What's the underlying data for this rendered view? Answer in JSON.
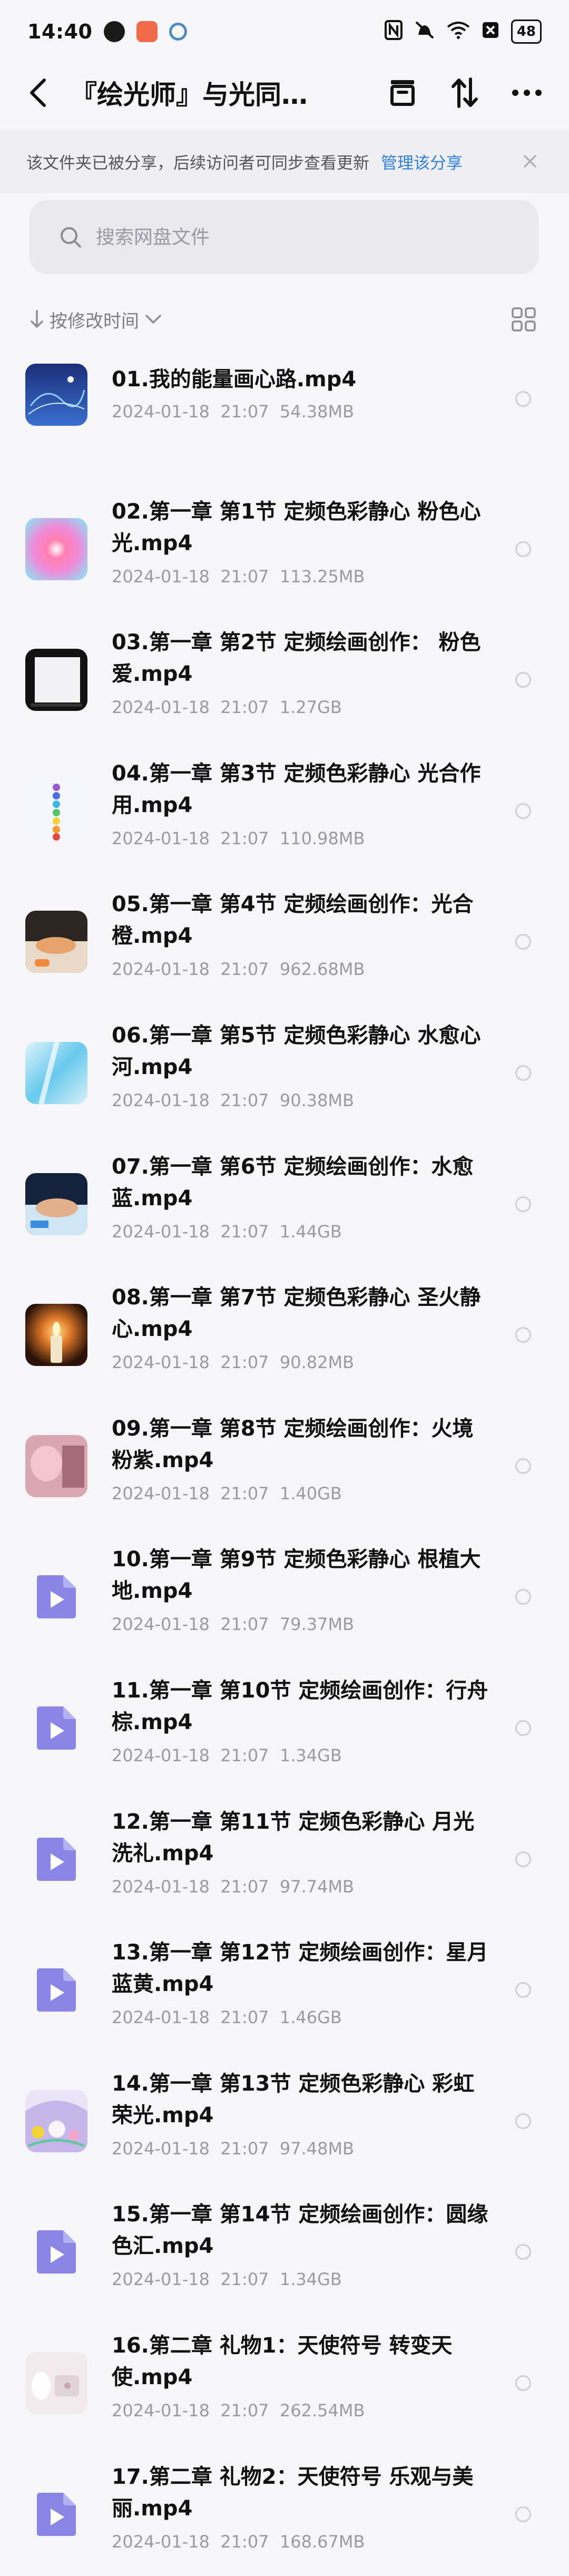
{
  "status_bar": {
    "time": "14:40",
    "battery": "48"
  },
  "header": {
    "title": "『绘光师』与光同…"
  },
  "notice": {
    "text": "该文件夹已被分享，后续访问者可同步查看更新",
    "link": "管理该分享"
  },
  "search": {
    "placeholder": "搜索网盘文件"
  },
  "sort": {
    "label": "按修改时间"
  },
  "colors": {
    "accent": "#2f7fd6",
    "video_icon": "#8a86e6",
    "meta_text": "#9a9aa2",
    "background": "#f6f6f8"
  },
  "files": [
    {
      "name": "01.我的能量画心路.mp4",
      "date": "2024-01-18",
      "time": "21:07",
      "size": "54.38MB",
      "thumb": "blue-lines"
    },
    {
      "name": "02.第一章 第1节 定频色彩静心 粉色心光.mp4",
      "date": "2024-01-18",
      "time": "21:07",
      "size": "113.25MB",
      "thumb": "pink-glow"
    },
    {
      "name": "03.第一章 第2节 定频绘画创作： 粉色 爱.mp4",
      "date": "2024-01-18",
      "time": "21:07",
      "size": "1.27GB",
      "thumb": "white-frame"
    },
    {
      "name": "04.第一章 第3节 定频色彩静心 光合作用.mp4",
      "date": "2024-01-18",
      "time": "21:07",
      "size": "110.98MB",
      "thumb": "chakra"
    },
    {
      "name": "05.第一章 第4节 定频绘画创作：光合 橙.mp4",
      "date": "2024-01-18",
      "time": "21:07",
      "size": "962.68MB",
      "thumb": "hand-orange"
    },
    {
      "name": "06.第一章 第5节 定频色彩静心 水愈心河.mp4",
      "date": "2024-01-18",
      "time": "21:07",
      "size": "90.38MB",
      "thumb": "water-blue"
    },
    {
      "name": "07.第一章 第6节 定频绘画创作：水愈 蓝.mp4",
      "date": "2024-01-18",
      "time": "21:07",
      "size": "1.44GB",
      "thumb": "hand-blue"
    },
    {
      "name": "08.第一章 第7节 定频色彩静心 圣火静心.mp4",
      "date": "2024-01-18",
      "time": "21:07",
      "size": "90.82MB",
      "thumb": "candle"
    },
    {
      "name": "09.第一章 第8节 定频绘画创作：火境 粉紫.mp4",
      "date": "2024-01-18",
      "time": "21:07",
      "size": "1.40GB",
      "thumb": "pink-hand"
    },
    {
      "name": "10.第一章 第9节 定频色彩静心 根植大地.mp4",
      "date": "2024-01-18",
      "time": "21:07",
      "size": "79.37MB",
      "thumb": "video"
    },
    {
      "name": "11.第一章 第10节 定频绘画创作：行舟 棕.mp4",
      "date": "2024-01-18",
      "time": "21:07",
      "size": "1.34GB",
      "thumb": "video"
    },
    {
      "name": "12.第一章 第11节 定频色彩静心 月光洗礼.mp4",
      "date": "2024-01-18",
      "time": "21:07",
      "size": "97.74MB",
      "thumb": "video"
    },
    {
      "name": "13.第一章 第12节 定频绘画创作：星月 蓝黄.mp4",
      "date": "2024-01-18",
      "time": "21:07",
      "size": "1.46GB",
      "thumb": "video"
    },
    {
      "name": "14.第一章 第13节 定频色彩静心 彩虹荣光.mp4",
      "date": "2024-01-18",
      "time": "21:07",
      "size": "97.48MB",
      "thumb": "rainbow"
    },
    {
      "name": "15.第一章 第14节 定频绘画创作：圆缘 色汇.mp4",
      "date": "2024-01-18",
      "time": "21:07",
      "size": "1.34GB",
      "thumb": "video"
    },
    {
      "name": "16.第二章 礼物1：天使符号 转变天使.mp4",
      "date": "2024-01-18",
      "time": "21:07",
      "size": "262.54MB",
      "thumb": "angel"
    },
    {
      "name": "17.第二章 礼物2：天使符号 乐观与美丽.mp4",
      "date": "2024-01-18",
      "time": "21:07",
      "size": "168.67MB",
      "thumb": "video"
    }
  ]
}
